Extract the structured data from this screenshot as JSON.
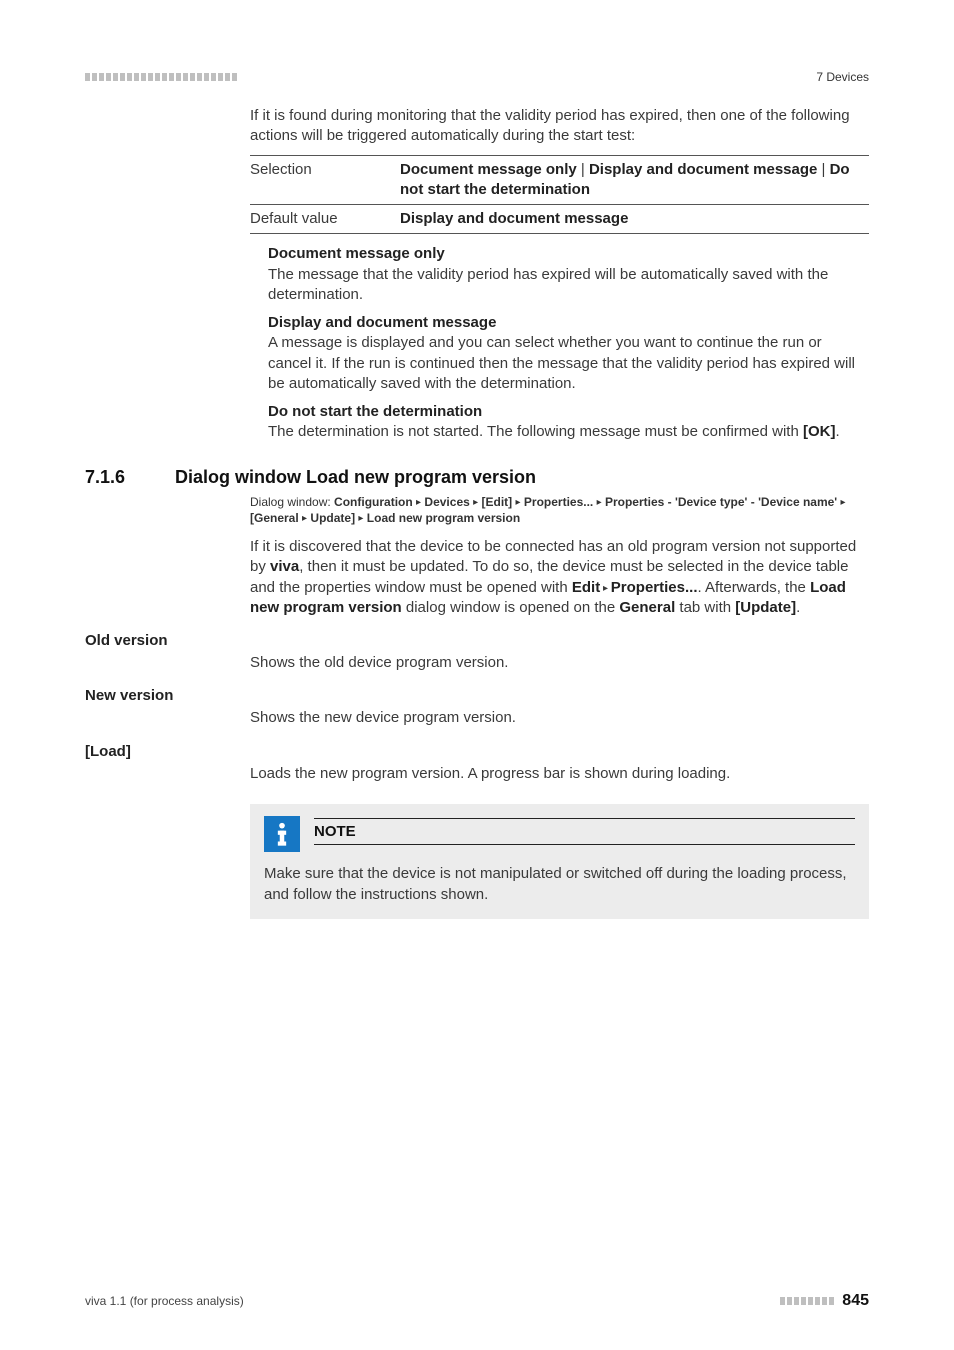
{
  "header": {
    "section_label": "7 Devices"
  },
  "intro": "If it is found during monitoring that the validity period has expired, then one of the following actions will be triggered automatically during the start test:",
  "spec_table": {
    "rows": [
      {
        "label": "Selection",
        "value_parts": [
          "Document message only",
          " | ",
          "Display and document message",
          " | ",
          "Do not start the determination"
        ]
      },
      {
        "label": "Default value",
        "value_parts": [
          "Display and document message"
        ]
      }
    ]
  },
  "definitions": [
    {
      "title": "Document message only",
      "body": "The message that the validity period has expired will be automatically saved with the determination."
    },
    {
      "title": "Display and document message",
      "body": "A message is displayed and you can select whether you want to continue the run or cancel it. If the run is continued then the message that the validity period has expired will be automatically saved with the determination."
    },
    {
      "title": "Do not start the determination",
      "body_prefix": "The determination is not started. The following message must be confirmed with ",
      "body_bold": "[OK]",
      "body_suffix": "."
    }
  ],
  "section": {
    "number": "7.1.6",
    "title": "Dialog window Load new program version",
    "dialog_path": {
      "label": "Dialog window: ",
      "segments": [
        "Configuration",
        "Devices",
        "[Edit]",
        "Properties...",
        "Properties - 'Device type' - 'Device name'",
        "[General",
        "Update]",
        "Load new program version"
      ]
    },
    "para": {
      "t1": "If it is discovered that the device to be connected has an old program version not supported by ",
      "viva": "viva",
      "t2": ", then it must be updated. To do so, the device must be selected in the device table and the properties window must be opened with ",
      "edit": "Edit",
      "tri": " ▸ ",
      "props": "Properties...",
      "t3": ". Afterwards, the ",
      "load": "Load new program version",
      "t4": " dialog window is opened on the ",
      "general": "General",
      "t5": " tab with ",
      "update": "[Update]",
      "t6": "."
    }
  },
  "fields": [
    {
      "label": "Old version",
      "body": "Shows the old device program version."
    },
    {
      "label": "New version",
      "body": "Shows the new device program version."
    },
    {
      "label": "[Load]",
      "body": "Loads the new program version. A progress bar is shown during loading."
    }
  ],
  "note": {
    "title": "NOTE",
    "body": "Make sure that the device is not manipulated or switched off during the loading process, and follow the instructions shown."
  },
  "footer": {
    "left": "viva 1.1 (for process analysis)",
    "page": "845"
  }
}
